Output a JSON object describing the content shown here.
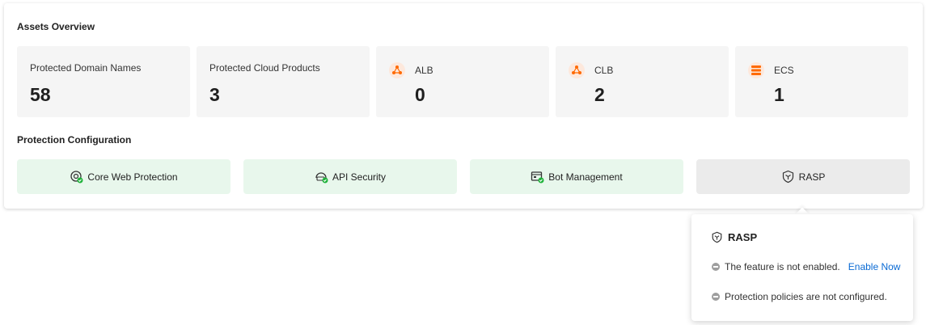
{
  "assets": {
    "title": "Assets Overview",
    "stats": [
      {
        "label": "Protected Domain Names",
        "value": "58"
      },
      {
        "label": "Protected Cloud Products",
        "value": "3"
      },
      {
        "label": "ALB",
        "value": "0",
        "icon": "alb-icon"
      },
      {
        "label": "CLB",
        "value": "2",
        "icon": "clb-icon"
      },
      {
        "label": "ECS",
        "value": "1",
        "icon": "ecs-icon"
      }
    ]
  },
  "protection": {
    "title": "Protection Configuration",
    "features": [
      {
        "label": "Core Web Protection",
        "enabled": true,
        "icon": "core-web-protection-icon"
      },
      {
        "label": "API Security",
        "enabled": true,
        "icon": "api-security-icon"
      },
      {
        "label": "Bot Management",
        "enabled": true,
        "icon": "bot-management-icon"
      },
      {
        "label": "RASP",
        "enabled": false,
        "icon": "rasp-icon"
      }
    ]
  },
  "popover": {
    "title": "RASP",
    "status_text": "The feature is not enabled.",
    "enable_link": "Enable Now",
    "policy_text": "Protection policies are not configured."
  },
  "colors": {
    "accent_orange": "#ff6a00",
    "enabled_bg": "#e8f7ec",
    "disabled_bg": "#ebebeb",
    "check_green": "#1fb33a",
    "link_blue": "#0a6ad4"
  }
}
